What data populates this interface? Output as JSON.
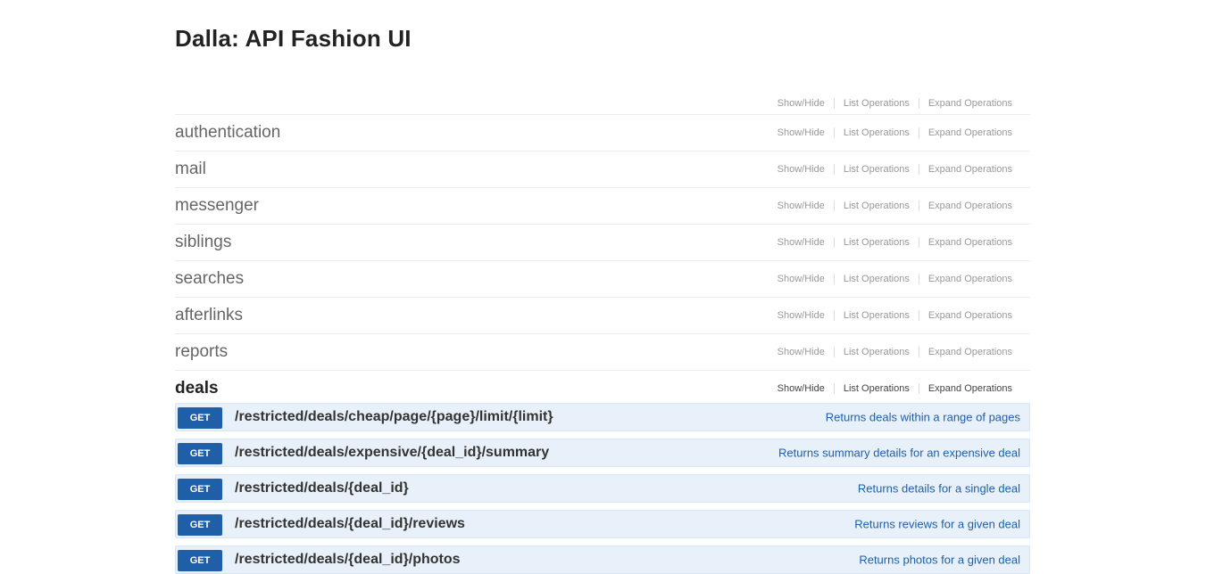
{
  "app": {
    "title": "Dalla: API Fashion UI"
  },
  "ops_labels": [
    "Show/Hide",
    "List Operations",
    "Expand Operations"
  ],
  "resources": [
    {
      "name": ""
    },
    {
      "name": "authentication"
    },
    {
      "name": "mail"
    },
    {
      "name": "messenger"
    },
    {
      "name": "siblings"
    },
    {
      "name": "searches"
    },
    {
      "name": "afterlinks"
    },
    {
      "name": "reports"
    },
    {
      "name": "deals"
    }
  ],
  "operations": [
    {
      "method": "GET",
      "path": "/restricted/deals/cheap/page/{page}/limit/{limit}",
      "desc": "Returns deals within a range of pages"
    },
    {
      "method": "GET",
      "path": "/restricted/deals/expensive/{deal_id}/summary",
      "desc": "Returns summary details for an expensive deal"
    },
    {
      "method": "GET",
      "path": "/restricted/deals/{deal_id}",
      "desc": "Returns details for a single deal"
    },
    {
      "method": "GET",
      "path": "/restricted/deals/{deal_id}/reviews",
      "desc": "Returns reviews for a given deal"
    },
    {
      "method": "GET",
      "path": "/restricted/deals/{deal_id}/photos",
      "desc": "Returns photos for a given deal"
    }
  ]
}
